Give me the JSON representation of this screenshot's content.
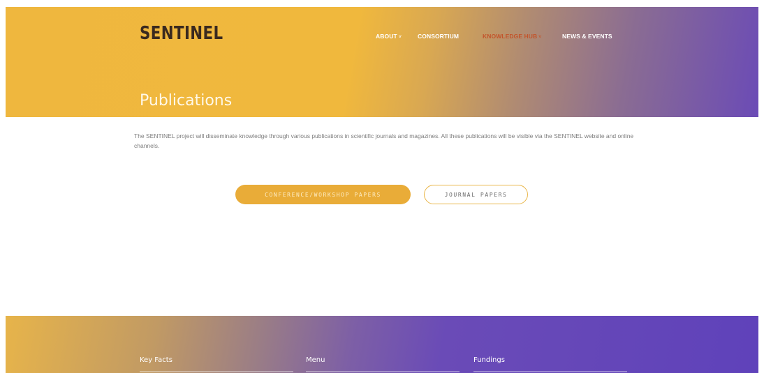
{
  "header": {
    "logo_text": "SENTINEL",
    "nav": {
      "about": "ABOUT",
      "consortium": "CONSORTIUM",
      "knowledge_hub": "KNOWLEDGE HUB",
      "news_events": "NEWS & EVENTS"
    },
    "dropdown_caret": "˅"
  },
  "hero": {
    "title": "Publications"
  },
  "content": {
    "intro": "The SENTINEL project will disseminate knowledge through various publications in scientific journals and magazines. All these publications will be visible via the SENTINEL website and online channels.",
    "buttons": {
      "conference": "CONFERENCE/WORKSHOP PAPERS",
      "journal": "JOURNAL PAPERS"
    }
  },
  "footer": {
    "columns": [
      "Key Facts",
      "Menu",
      "Fundings"
    ]
  },
  "colors": {
    "accent_orange": "#e9ac38",
    "accent_purple": "#5f42ba",
    "active_nav": "#c3542b"
  }
}
